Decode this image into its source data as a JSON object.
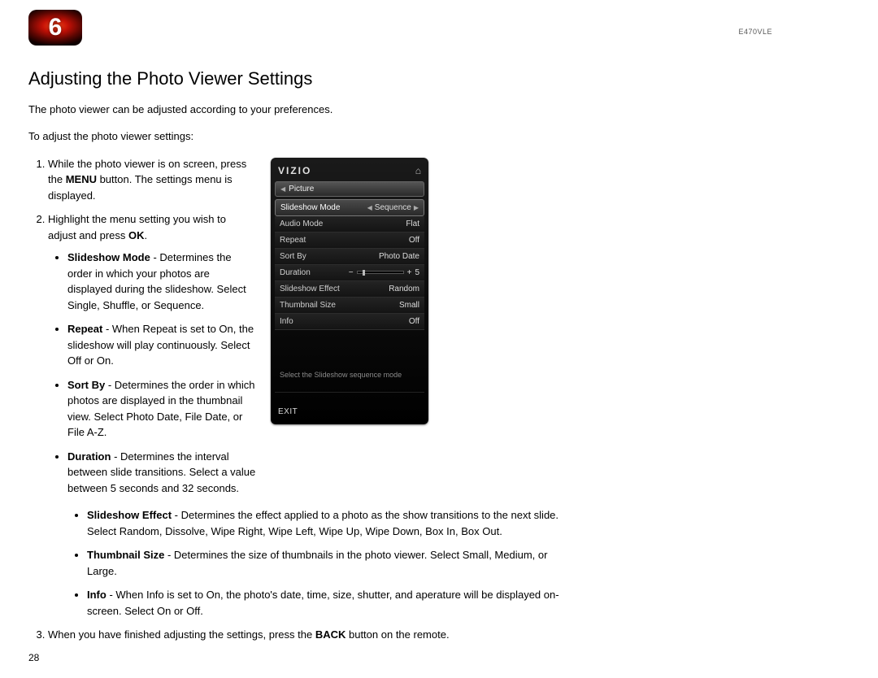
{
  "chapter_number": "6",
  "model": "E470VLE",
  "section_title": "Adjusting the Photo Viewer Settings",
  "intro1": "The photo viewer can be adjusted according to your preferences.",
  "intro2": "To adjust the photo viewer settings:",
  "step1_a": "While the photo viewer is on screen, press the ",
  "step1_b": "MENU",
  "step1_c": " button. The settings menu is displayed.",
  "step2_a": "Highlight the menu setting you wish to adjust and press ",
  "step2_b": "OK",
  "step2_c": ".",
  "opt_slideshow_mode_label": "Slideshow Mode",
  "opt_slideshow_mode_text": " - Determines the order in which your photos are displayed during the slideshow. Select Single, Shuffle, or Sequence.",
  "opt_repeat_label": "Repeat",
  "opt_repeat_text": " - When Repeat is set to On, the slideshow will play continuously. Select Off or On.",
  "opt_sortby_label": "Sort By",
  "opt_sortby_text": " - Determines the order in which photos are displayed in the thumbnail view. Select Photo Date, File Date, or File A-Z.",
  "opt_duration_label": "Duration",
  "opt_duration_text": " - Determines the interval between slide transitions. Select a value between 5 seconds and 32 seconds.",
  "opt_effect_label": "Slideshow Effect",
  "opt_effect_text": " - Determines the effect applied to a photo as the show transitions to the next slide. Select Random, Dissolve, Wipe Right, Wipe Left, Wipe Up, Wipe Down, Box In, Box Out.",
  "opt_thumb_label": "Thumbnail Size",
  "opt_thumb_text": " - Determines the size of thumbnails in the photo viewer. Select Small, Medium, or Large.",
  "opt_info_label": "Info",
  "opt_info_text": " - When Info is set to On, the photo's date, time, size, shutter, and aperature will be displayed on-screen. Select On or Off.",
  "step3_a": "When you have finished adjusting the settings, press the ",
  "step3_b": "BACK",
  "step3_c": " button on the remote.",
  "page_number": "28",
  "osd": {
    "logo": "VIZIO",
    "header": "Picture",
    "rows": {
      "slideshow_mode": {
        "label": "Slideshow Mode",
        "value": "Sequence"
      },
      "audio_mode": {
        "label": "Audio Mode",
        "value": "Flat"
      },
      "repeat": {
        "label": "Repeat",
        "value": "Off"
      },
      "sort_by": {
        "label": "Sort By",
        "value": "Photo Date"
      },
      "duration": {
        "label": "Duration",
        "value": "5"
      },
      "effect": {
        "label": "Slideshow Effect",
        "value": "Random"
      },
      "thumb": {
        "label": "Thumbnail Size",
        "value": "Small"
      },
      "info": {
        "label": "Info",
        "value": "Off"
      }
    },
    "hint": "Select the Slideshow sequence mode",
    "exit": "EXIT"
  }
}
